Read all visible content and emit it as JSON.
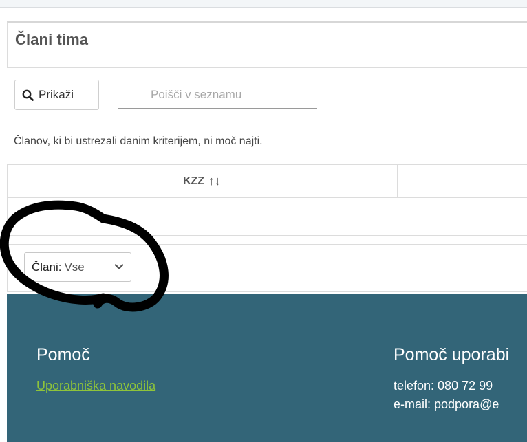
{
  "panel": {
    "title": "Člani tima"
  },
  "toolbar": {
    "show_label": "Prikaži",
    "search_placeholder": "Poišči v seznamu"
  },
  "empty_message": "Članov, ki bi ustrezali danim kriterijem, ni moč najti.",
  "table": {
    "columns": [
      {
        "label": "KZZ",
        "sort_icon": "↑↓"
      }
    ]
  },
  "filter": {
    "label": "Člani:",
    "selected": "Vse"
  },
  "footer": {
    "help_title": "Pomoč",
    "help_link": "Uporabniška navodila",
    "support_title": "Pomoč uporabi",
    "phone": "telefon: 080 72 99",
    "email": "e-mail: podpora@e"
  },
  "colors": {
    "footer_bg": "#336578",
    "link": "#8fc43a"
  },
  "icons": [
    "search-icon",
    "sort-icon",
    "chevron-down-icon"
  ]
}
